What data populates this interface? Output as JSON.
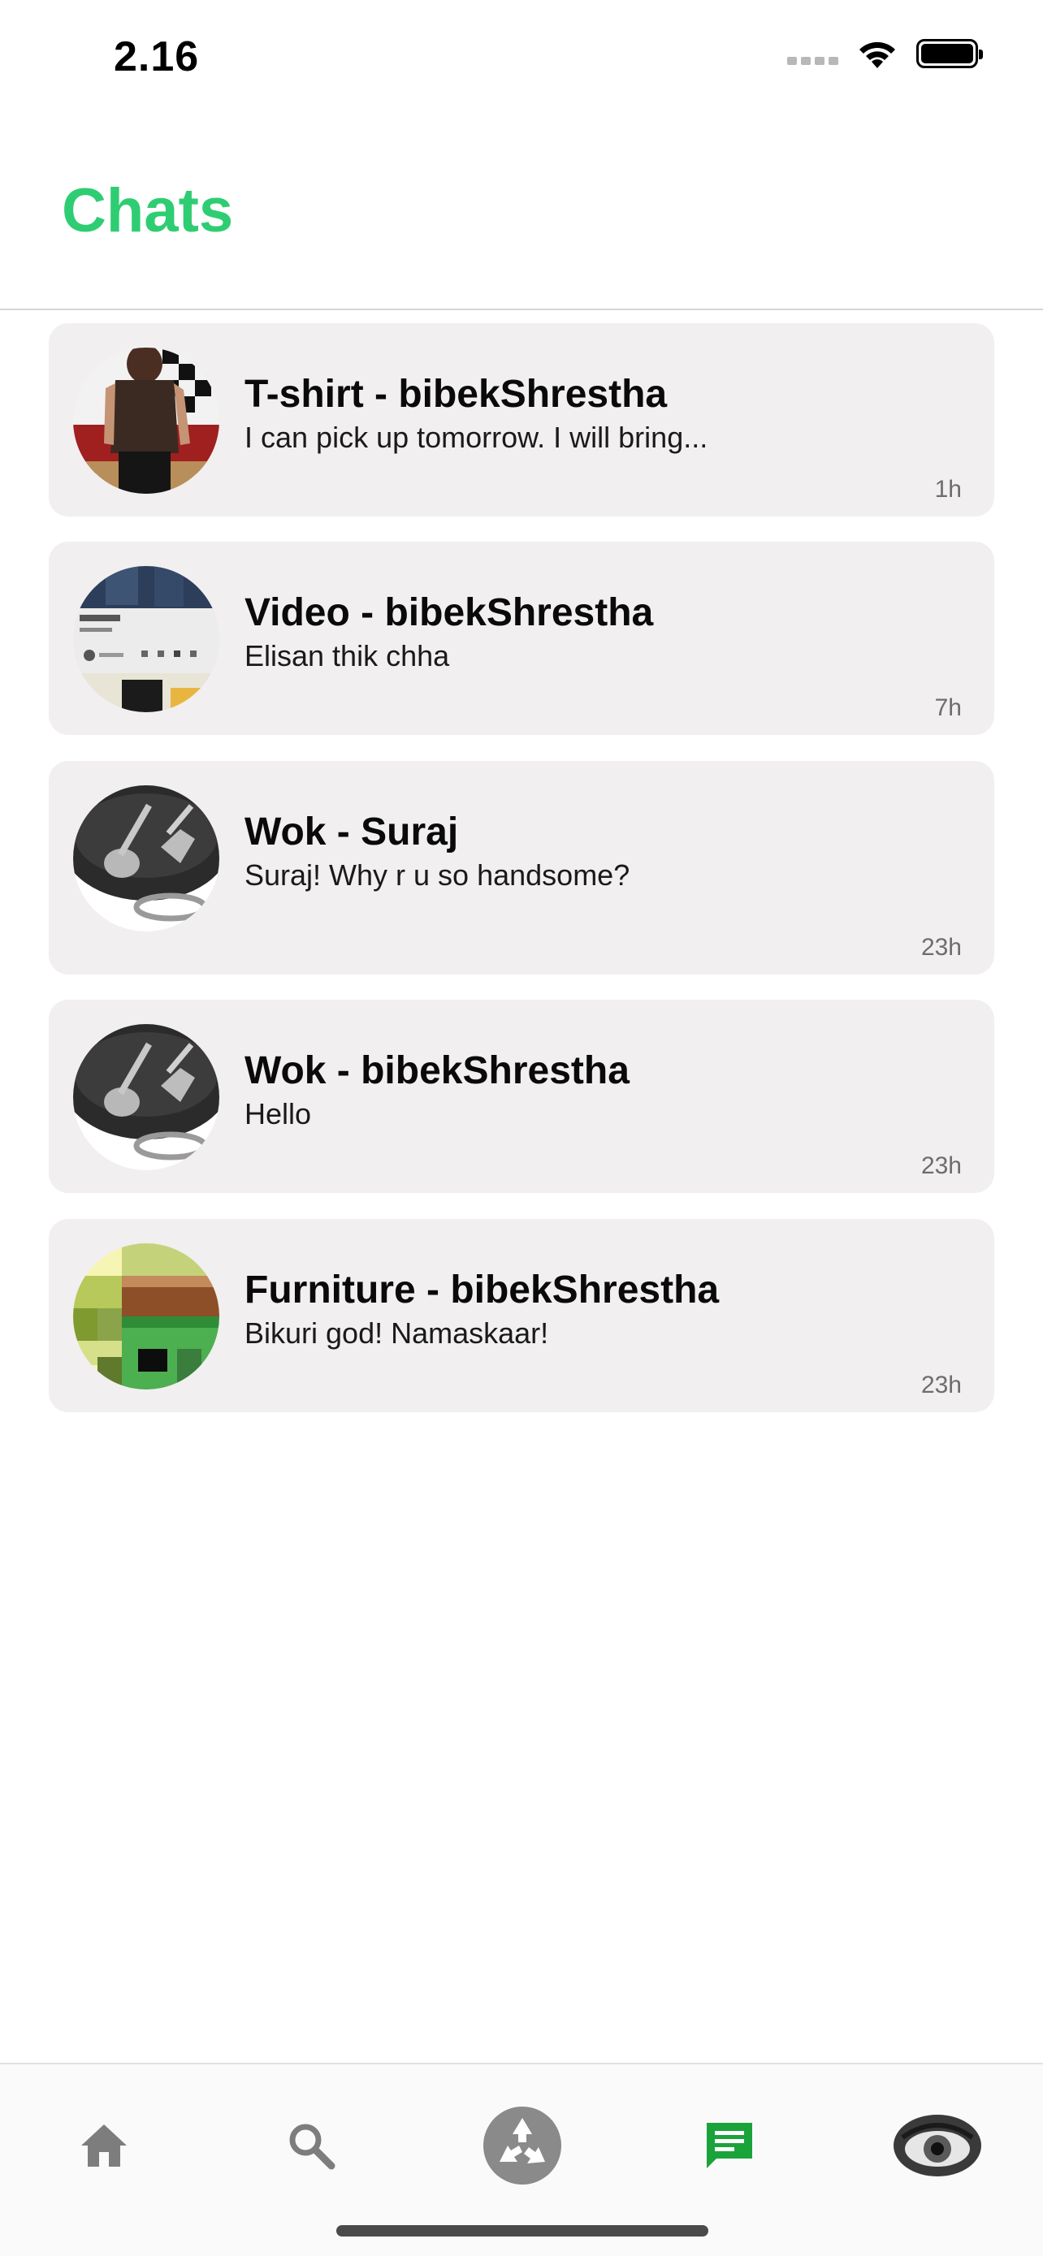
{
  "status_bar": {
    "time": "2.16"
  },
  "header": {
    "title": "Chats"
  },
  "chats": [
    {
      "title": "T-shirt - bibekShrestha",
      "preview": "I can pick up tomorrow. I will bring...",
      "time": "1h",
      "avatar": "t-shirt-photo"
    },
    {
      "title": "Video - bibekShrestha",
      "preview": "Elisan thik chha",
      "time": "7h",
      "avatar": "video-screenshot"
    },
    {
      "title": "Wok - Suraj",
      "preview": "Suraj! Why r u so handsome?",
      "time": "23h",
      "avatar": "wok-photo"
    },
    {
      "title": "Wok - bibekShrestha",
      "preview": "Hello",
      "time": "23h",
      "avatar": "wok-photo"
    },
    {
      "title": "Furniture - bibekShrestha",
      "preview": "Bikuri god! Namaskaar!",
      "time": "23h",
      "avatar": "furniture-pixel-image"
    }
  ],
  "tab_bar": {
    "tabs": [
      {
        "icon": "home-icon",
        "active": false
      },
      {
        "icon": "search-icon",
        "active": false
      },
      {
        "icon": "recycle-icon",
        "active": false
      },
      {
        "icon": "chat-icon",
        "active": true
      },
      {
        "icon": "profile-eye-avatar",
        "active": false
      }
    ]
  },
  "colors": {
    "accent": "#2fcd73",
    "active_tab": "#1aa33a",
    "inactive_tab": "#7d7d7d",
    "card_background": "#f1eff0"
  }
}
